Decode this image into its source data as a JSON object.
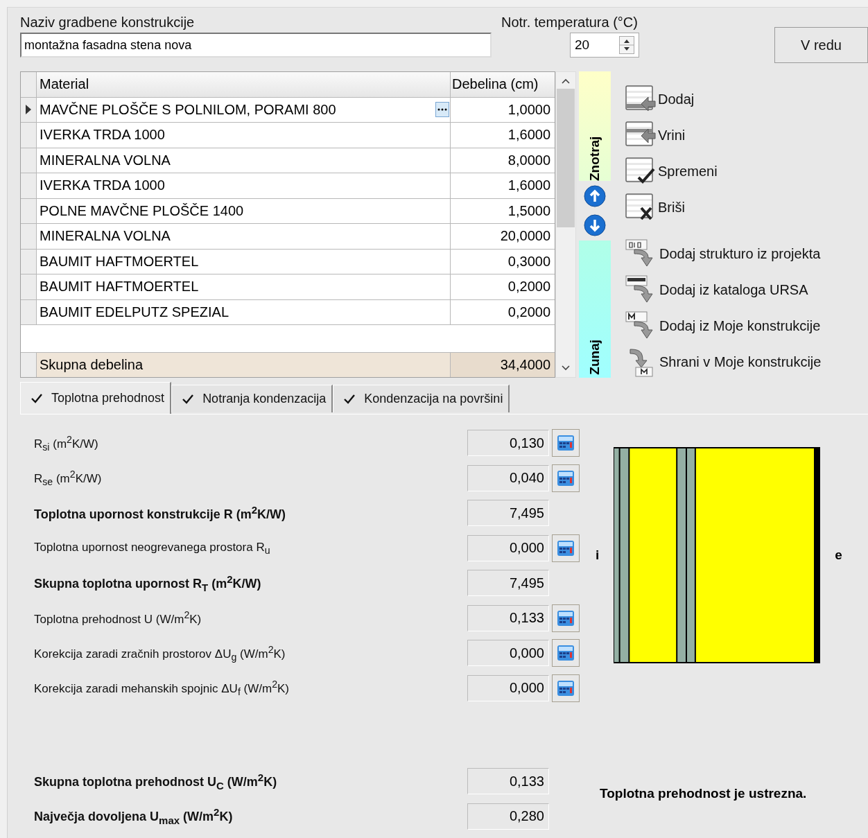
{
  "header": {
    "name_label": "Naziv gradbene konstrukcije",
    "name_value": "montažna fasadna stena nova",
    "temp_label": "Notr. temperatura (°C)",
    "temp_value": "20"
  },
  "ok_button": "V redu",
  "table": {
    "columns": [
      "Material",
      "Debelina (cm)"
    ],
    "rows": [
      {
        "material": "MAVČNE PLOŠČE S POLNILOM, PORAMI 800",
        "thickness": "1,0000",
        "selected": true,
        "color": "#94b0a4"
      },
      {
        "material": "IVERKA TRDA 1000",
        "thickness": "1,6000",
        "selected": false,
        "color": "#94b0a4"
      },
      {
        "material": "MINERALNA VOLNA",
        "thickness": "8,0000",
        "selected": false,
        "color": "#ffff00"
      },
      {
        "material": "IVERKA TRDA 1000",
        "thickness": "1,6000",
        "selected": false,
        "color": "#94b0a4"
      },
      {
        "material": "POLNE MAVČNE PLOŠČE 1400",
        "thickness": "1,5000",
        "selected": false,
        "color": "#94b0a4"
      },
      {
        "material": "MINERALNA VOLNA",
        "thickness": "20,0000",
        "selected": false,
        "color": "#ffff00"
      },
      {
        "material": "BAUMIT HAFTMOERTEL",
        "thickness": "0,3000",
        "selected": false,
        "color": "#000000"
      },
      {
        "material": "BAUMIT HAFTMOERTEL",
        "thickness": "0,2000",
        "selected": false,
        "color": "#000000"
      },
      {
        "material": "BAUMIT EDELPUTZ SPEZIAL",
        "thickness": "0,2000",
        "selected": false,
        "color": "#000000"
      }
    ],
    "total_label": "Skupna debelina",
    "total_value": "34,4000"
  },
  "side_labels": {
    "inside": "Znotraj",
    "outside": "Zunaj"
  },
  "row_actions": [
    {
      "kind": "add",
      "label": "Dodaj"
    },
    {
      "kind": "insert",
      "label": "Vrini"
    },
    {
      "kind": "change",
      "label": "Spremeni"
    },
    {
      "kind": "delete",
      "label": "Briši"
    }
  ],
  "import_actions": [
    {
      "kind": "project",
      "label": "Dodaj strukturo iz projekta"
    },
    {
      "kind": "catalog",
      "label": "Dodaj iz kataloga URSA"
    },
    {
      "kind": "mine",
      "label": "Dodaj iz Moje konstrukcije"
    },
    {
      "kind": "save",
      "label": "Shrani v Moje konstrukcije"
    }
  ],
  "tabs": [
    {
      "label": "Toplotna prehodnost",
      "selected": true
    },
    {
      "label": "Notranja kondenzacija",
      "selected": false
    },
    {
      "label": "Kondenzacija na površini",
      "selected": false
    }
  ],
  "results": [
    {
      "label": "R$_{si}$ (m$^{2}$K/W)",
      "value": "0,130",
      "bold": false,
      "calculator": true
    },
    {
      "label": "R$_{se}$ (m$^{2}$K/W)",
      "value": "0,040",
      "bold": false,
      "calculator": true
    },
    {
      "label": "Toplotna upornost konstrukcije R (m$^{2}$K/W)",
      "value": "7,495",
      "bold": true,
      "calculator": false
    },
    {
      "label": "Toplotna upornost neogrevanega prostora R$_{u}$",
      "value": "0,000",
      "bold": false,
      "calculator": true
    },
    {
      "label": "Skupna toplotna upornost R$_{T}$ (m$^{2}$K/W)",
      "value": "7,495",
      "bold": true,
      "calculator": false
    },
    {
      "label": "Toplotna prehodnost  U (W/m$^{2}$K)",
      "value": "0,133",
      "bold": false,
      "calculator": true
    },
    {
      "label": "Korekcija zaradi zračnih prostorov ΔU$_{g}$ (W/m$^{2}$K)",
      "value": "0,000",
      "bold": false,
      "calculator": true
    },
    {
      "label": "Korekcija zaradi mehanskih spojnic ΔU$_{f}$ (W/m$^{2}$K)",
      "value": "0,000",
      "bold": false,
      "calculator": true
    }
  ],
  "summary": [
    {
      "label": "Skupna toplotna prehodnost U$_{C}$ (W/m$^{2}$K)",
      "value": "0,133",
      "bold": true
    },
    {
      "label": "Največja dovoljena U$_{max}$ (W/m$^{2}$K)",
      "value": "0,280",
      "bold": true
    }
  ],
  "diagram": {
    "inside_label": "i",
    "outside_label": "e"
  },
  "verdict": "Toplotna prehodnost je ustrezna."
}
